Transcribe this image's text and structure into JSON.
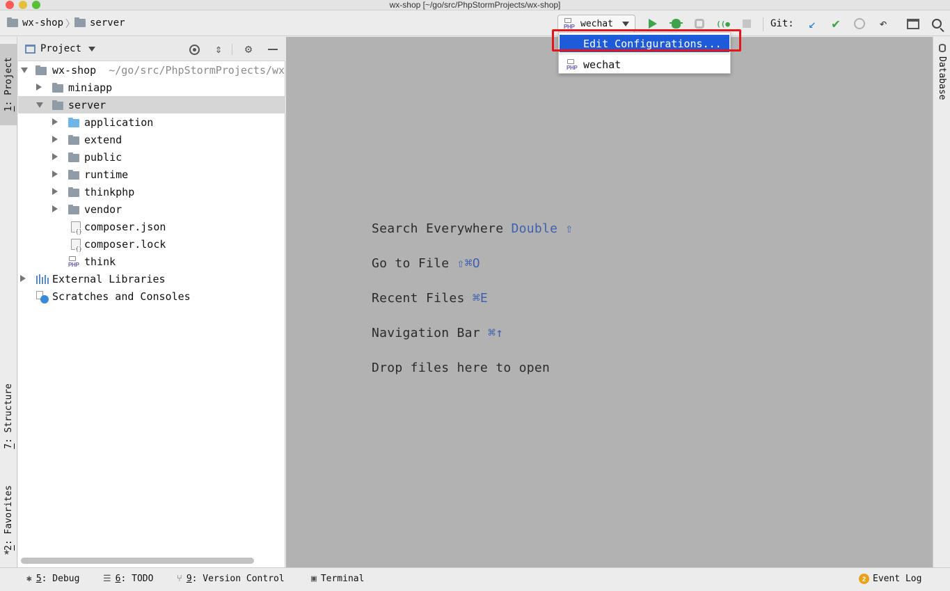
{
  "window": {
    "title": "wx-shop [~/go/src/PhpStormProjects/wx-shop]"
  },
  "navbar": {
    "crumbs": [
      "wx-shop",
      "server"
    ],
    "crumb_separator": "〉",
    "run_config": "wechat",
    "php_badge": "PHP",
    "git_label": "Git:"
  },
  "left_tabs": {
    "project": {
      "num": "1",
      "label": ": Project"
    },
    "structure": {
      "num": "7",
      "label": ": Structure"
    },
    "favorites": {
      "num": "2",
      "label": ": Favorites"
    }
  },
  "right_tabs": {
    "database": "Database"
  },
  "project_panel": {
    "title": "Project",
    "tree": [
      {
        "label": "wx-shop",
        "path": "~/go/src/PhpStormProjects/wx-shop"
      },
      {
        "label": "miniapp"
      },
      {
        "label": "server"
      },
      {
        "label": "application"
      },
      {
        "label": "extend"
      },
      {
        "label": "public"
      },
      {
        "label": "runtime"
      },
      {
        "label": "thinkphp"
      },
      {
        "label": "vendor"
      },
      {
        "label": "composer.json"
      },
      {
        "label": "composer.lock"
      },
      {
        "label": "think"
      },
      {
        "label": "External Libraries"
      },
      {
        "label": "Scratches and Consoles"
      }
    ]
  },
  "editor_hints": [
    {
      "text": "Search Everywhere ",
      "key": "Double ⇧"
    },
    {
      "text": "Go to File ",
      "key": "⇧⌘O"
    },
    {
      "text": "Recent Files ",
      "key": "⌘E"
    },
    {
      "text": "Navigation Bar ",
      "key": "⌘↑"
    },
    {
      "text": "Drop files here to open",
      "key": ""
    }
  ],
  "run_popup": {
    "edit_label": "Edit Configurations...",
    "item_label": "wechat"
  },
  "statusbar": {
    "debug": {
      "num": "5",
      "label": ": Debug"
    },
    "todo": {
      "num": "6",
      "label": ": TODO"
    },
    "vcs": {
      "num": "9",
      "label": ": Version Control"
    },
    "terminal": "Terminal",
    "event_log": "Event Log",
    "event_count": "2"
  },
  "colors": {
    "accent": "#1e5bd9",
    "highlight": "#e8141b",
    "run_green": "#3fa34b",
    "editor_bg": "#b2b2b2"
  }
}
